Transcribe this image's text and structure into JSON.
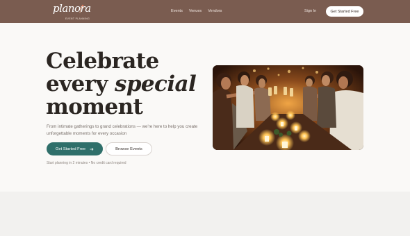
{
  "nav": {
    "logo_text": "planora",
    "logo_tagline": "EVENT PLANNING",
    "links": [
      "Events",
      "Venues",
      "Vendors"
    ],
    "signin_label": "Sign In",
    "cta_label": "Get Started Free"
  },
  "hero": {
    "title_line1": "Celebrate",
    "title_line2_a": "every ",
    "title_line2_b": "special",
    "title_line3": "moment",
    "description": "From intimate gatherings to grand celebrations — we're here to help you create unforgettable moments for every occasion",
    "primary_button": "Get Started Free",
    "secondary_button": "Browse Events",
    "note": "Start planning in 2 minutes • No credit card required"
  },
  "colors": {
    "nav_bg": "#7a5c50",
    "primary": "#2f6f6a",
    "page_bg": "#faf9f7"
  },
  "icons": {
    "arrow": "arrow-right-icon"
  }
}
